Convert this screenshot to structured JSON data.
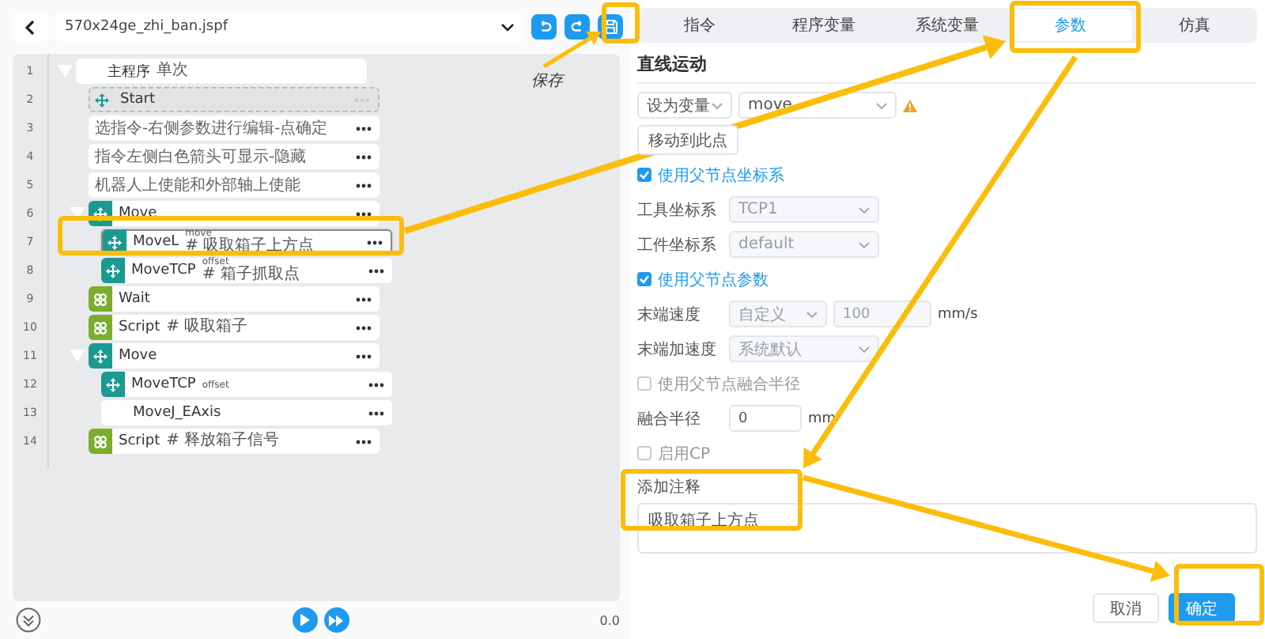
{
  "file": {
    "name": "570x24ge_zhi_ban.jspf"
  },
  "program": {
    "line": "1",
    "kind": "root",
    "label": "主程序",
    "note": "单次",
    "expanded": true,
    "selected": false,
    "children": [
      {
        "line": "2",
        "kind": "start",
        "label": "Start",
        "selected": false
      },
      {
        "line": "3",
        "kind": "comment",
        "label": "选指令-右侧参数进行编辑-点确定",
        "selected": false
      },
      {
        "line": "4",
        "kind": "comment",
        "label": "指令左侧白色箭头可显示-隐藏",
        "selected": false
      },
      {
        "line": "5",
        "kind": "comment",
        "label": "机器人上使能和外部轴上使能",
        "selected": false
      },
      {
        "line": "6",
        "kind": "move",
        "label": "Move",
        "expanded": true,
        "selected": false,
        "children": [
          {
            "line": "7",
            "kind": "move",
            "label": "MoveL",
            "tag": "move",
            "note": "# 吸取箱子上方点",
            "selected": true
          },
          {
            "line": "8",
            "kind": "move",
            "label": "MoveTCP",
            "tag": "offset",
            "note": "# 箱子抓取点",
            "selected": false
          }
        ]
      },
      {
        "line": "9",
        "kind": "logic",
        "label": "Wait",
        "selected": false
      },
      {
        "line": "10",
        "kind": "logic",
        "label": "Script",
        "note": "# 吸取箱子",
        "selected": false
      },
      {
        "line": "11",
        "kind": "move",
        "label": "Move",
        "expanded": true,
        "selected": false,
        "children": [
          {
            "line": "12",
            "kind": "move",
            "label": "MoveTCP",
            "tag": "offset",
            "selected": false
          },
          {
            "line": "13",
            "kind": "plain",
            "label": "MoveJ_EAxis",
            "selected": false
          }
        ]
      },
      {
        "line": "14",
        "kind": "logic",
        "label": "Script",
        "note": "# 释放箱子信号",
        "selected": false
      }
    ]
  },
  "footer": {
    "time": "0.0"
  },
  "annotation_label": "保存",
  "tabs": [
    {
      "label": "指令",
      "selected": false
    },
    {
      "label": "程序变量",
      "selected": false
    },
    {
      "label": "系统变量",
      "selected": false
    },
    {
      "label": "参数",
      "selected": true
    },
    {
      "label": "仿真",
      "selected": false
    }
  ],
  "params": {
    "heading": "直线运动",
    "rows": [
      {
        "kind": "field",
        "controls": [
          {
            "kind": "select",
            "value": "设为变量",
            "disabled": false
          },
          {
            "kind": "select",
            "value": "move",
            "disabled": false
          }
        ],
        "warning": true
      },
      {
        "kind": "button",
        "label": "移动到此点"
      },
      {
        "kind": "checkbox",
        "label": "使用父节点坐标系",
        "checked": true
      },
      {
        "kind": "field",
        "label": "工具坐标系",
        "controls": [
          {
            "kind": "select",
            "value": "TCP1",
            "disabled": true
          }
        ]
      },
      {
        "kind": "field",
        "label": "工件坐标系",
        "controls": [
          {
            "kind": "select",
            "value": "default",
            "disabled": true
          }
        ]
      },
      {
        "kind": "checkbox",
        "label": "使用父节点参数",
        "checked": true
      },
      {
        "kind": "field",
        "label": "末端速度",
        "controls": [
          {
            "kind": "select",
            "value": "自定义",
            "disabled": true
          },
          {
            "kind": "input",
            "value": "100",
            "disabled": true
          }
        ],
        "unit": "mm/s"
      },
      {
        "kind": "field",
        "label": "末端加速度",
        "controls": [
          {
            "kind": "select",
            "value": "系统默认",
            "disabled": true
          }
        ]
      },
      {
        "kind": "checkbox",
        "label": "使用父节点融合半径",
        "checked": false
      },
      {
        "kind": "field",
        "label": "融合半径",
        "controls": [
          {
            "kind": "input",
            "value": "0",
            "disabled": false
          }
        ],
        "unit": "mm"
      },
      {
        "kind": "checkbox",
        "label": "启用CP",
        "checked": false
      }
    ],
    "comment": {
      "label": "添加注释",
      "value": "吸取箱子上方点"
    }
  },
  "buttons": [
    {
      "label": "取消",
      "primary": false
    },
    {
      "label": "确定",
      "primary": true
    }
  ]
}
